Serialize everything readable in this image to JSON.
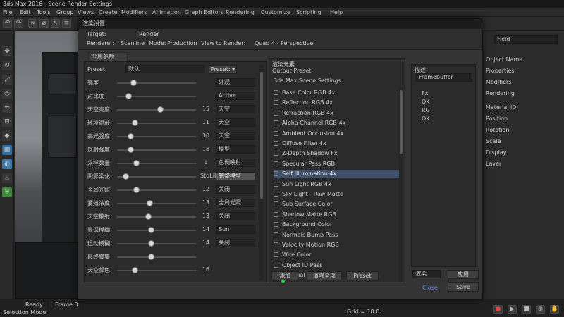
{
  "app": {
    "title": "3ds Max 2016 - Scene Render Settings",
    "menu": [
      "File",
      "Edit",
      "Tools",
      "Group",
      "Views",
      "Create",
      "Modifiers",
      "Animation",
      "Graph Editors",
      "Rendering",
      "Customize",
      "Scripting",
      "Help"
    ]
  },
  "dialog": {
    "title": "渲染设置",
    "toolbar": {
      "row1": [
        "Target:",
        "Render"
      ],
      "row2": [
        "Renderer:",
        "Scanline",
        "Mode:",
        "Production",
        "View to Render:",
        "Quad 4 - Perspective"
      ]
    },
    "tab": "公用参数",
    "preset_label": "Preset:",
    "preset_value": "默认",
    "preset_button": "Preset: ▾",
    "params": [
      {
        "label": "亮度",
        "value": "",
        "option": "外观"
      },
      {
        "label": "对比度",
        "value": "",
        "option": "Active"
      },
      {
        "label": "天空亮度",
        "value": "15",
        "option": "天空"
      },
      {
        "label": "环境遮蔽",
        "value": "11",
        "option": "天空"
      },
      {
        "label": "高光强度",
        "value": "30",
        "option": "天空"
      },
      {
        "label": "反射强度",
        "value": "18",
        "option": "模型"
      },
      {
        "label": "采样数量",
        "value": "↓",
        "option": "色调映射"
      },
      {
        "label": "阴影柔化",
        "value": "StdLib",
        "option": "完整模型"
      },
      {
        "label": "全局光照",
        "value": "12",
        "option": "关闭"
      },
      {
        "label": "雾效浓度",
        "value": "13",
        "option": "全局光照"
      },
      {
        "label": "天空散射",
        "value": "13",
        "option": "关闭"
      },
      {
        "label": "景深模糊",
        "value": "14",
        "option": "Sun"
      },
      {
        "label": "运动模糊",
        "value": "14",
        "option": "关闭"
      },
      {
        "label": "最终聚集",
        "value": "",
        "option": ""
      },
      {
        "label": "天空颜色",
        "value": "16",
        "option": ""
      }
    ],
    "list_title": "渲染元素",
    "list_subtitle": "Output Preset",
    "list_header": "3ds Max Scene Settings",
    "list_items": [
      "Base Color RGB 4x",
      "Reflection RGB 4x",
      "Refraction RGB 4x",
      "Alpha Channel RGB 4x",
      "Ambient Occlusion 4x",
      "Diffuse Filter 4x",
      "Z-Depth Shadow Fx",
      "Specular Pass RGB",
      "Self Illumination 4x",
      "Sun Light RGB 4x",
      "Sky Light - Raw Matte",
      "Sub Surface Color",
      "Shadow Matte RGB",
      "Background Color",
      "Normals Bump Pass",
      "Velocity Motion RGB",
      "Wire Color",
      "Object ID Pass",
      "Material ID Pass"
    ],
    "selected_index": 8,
    "list_buttons": [
      "添加",
      "清除全部",
      "Preset"
    ],
    "side_title": "描述",
    "side_field": "Framebuffer",
    "side_items": [
      "Fx",
      "OK",
      "RG",
      "OK"
    ],
    "bottom_select": "渲染",
    "apply_button": "应用",
    "cancel_link": "Close",
    "render_button": "Save"
  },
  "right_panel": {
    "search": "Field",
    "items": [
      "Object Name",
      "Properties",
      "Modifiers",
      "Rendering",
      "Material ID",
      "Position",
      "Rotation",
      "Scale",
      "Display",
      "Layer"
    ]
  },
  "status": {
    "left": "Selection Mode",
    "cells": [
      "Ready",
      "Frame 0"
    ],
    "grid": "Grid = 10.0"
  }
}
